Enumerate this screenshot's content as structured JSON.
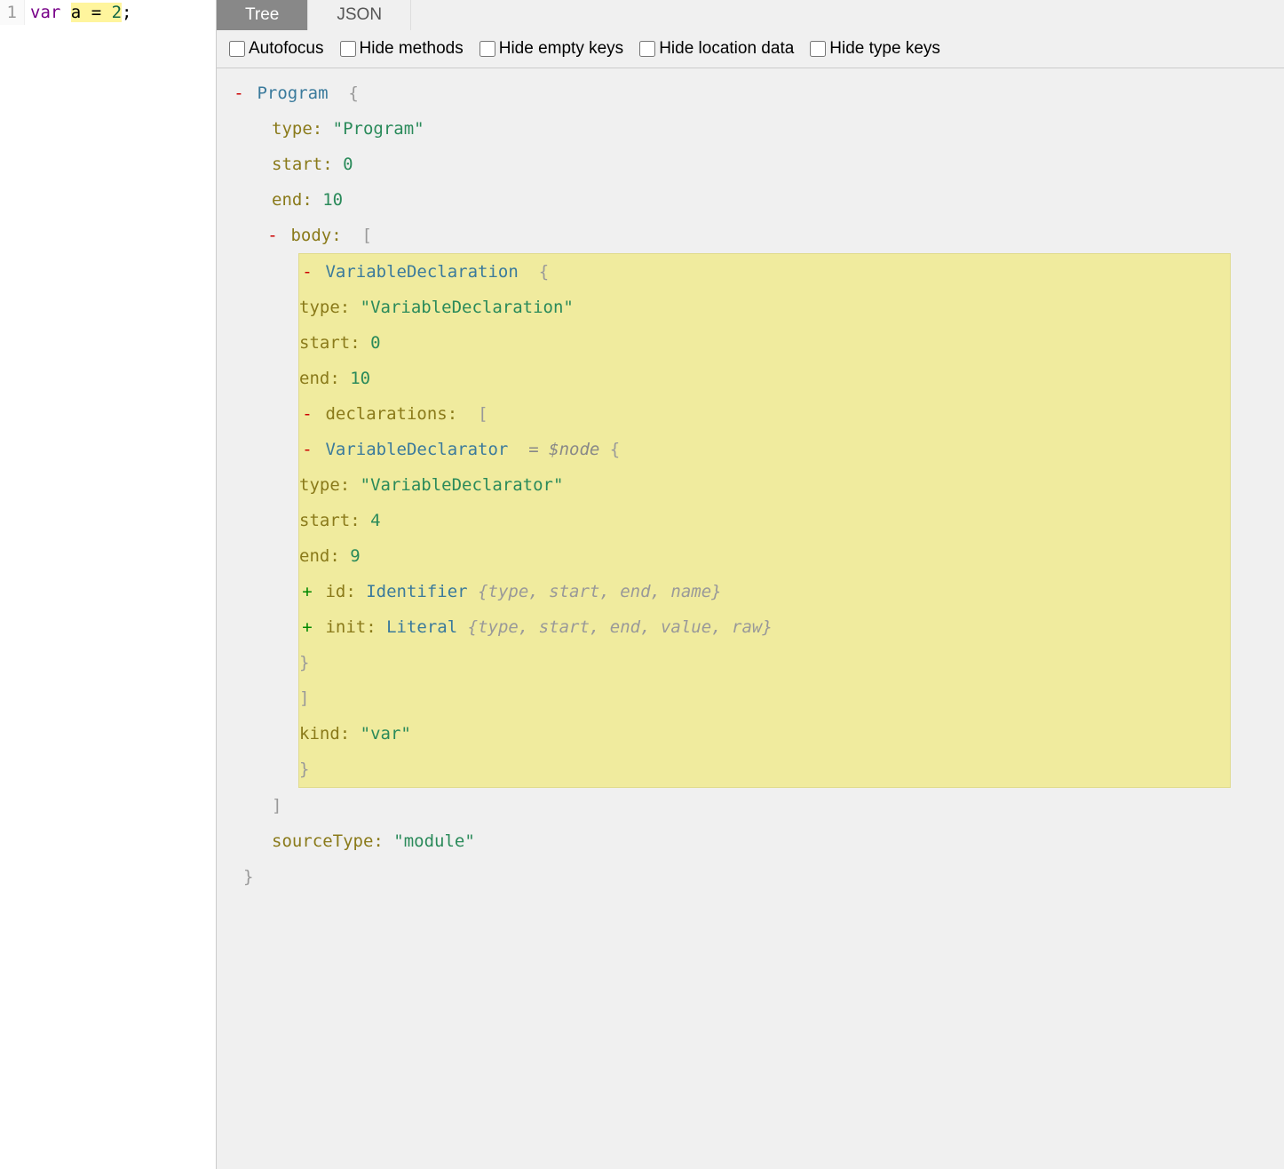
{
  "editor": {
    "line_number": "1",
    "tokens": {
      "keyword": "var",
      "sp1": " ",
      "varname": "a",
      "sp2": " ",
      "op": "=",
      "sp3": " ",
      "num": "2",
      "semi": ";"
    }
  },
  "tabs": {
    "tree": "Tree",
    "json": "JSON"
  },
  "options": {
    "autofocus": "Autofocus",
    "hide_methods": "Hide methods",
    "hide_empty": "Hide empty keys",
    "hide_location": "Hide location data",
    "hide_type": "Hide type keys"
  },
  "tree": {
    "program": {
      "name": "Program",
      "open": "{",
      "type_k": "type:",
      "type_v": "\"Program\"",
      "start_k": "start:",
      "start_v": "0",
      "end_k": "end:",
      "end_v": "10",
      "body_k": "body:",
      "body_open": "[",
      "body_close": "]",
      "sourceType_k": "sourceType:",
      "sourceType_v": "\"module\"",
      "close": "}"
    },
    "vardecl": {
      "name": "VariableDeclaration",
      "open": "{",
      "type_k": "type:",
      "type_v": "\"VariableDeclaration\"",
      "start_k": "start:",
      "start_v": "0",
      "end_k": "end:",
      "end_v": "10",
      "declarations_k": "declarations:",
      "declarations_open": "[",
      "declarations_close": "]",
      "kind_k": "kind:",
      "kind_v": "\"var\"",
      "close": "}"
    },
    "vardeclarator": {
      "name": "VariableDeclarator",
      "nodevar": "= $node",
      "open": "{",
      "type_k": "type:",
      "type_v": "\"VariableDeclarator\"",
      "start_k": "start:",
      "start_v": "4",
      "end_k": "end:",
      "end_v": "9",
      "id_k": "id:",
      "id_name": "Identifier",
      "id_hint": "{type, start, end, name}",
      "init_k": "init:",
      "init_name": "Literal",
      "init_hint": "{type, start, end, value, raw}",
      "close": "}"
    },
    "sym": {
      "minus": "-",
      "plus": "+"
    }
  }
}
